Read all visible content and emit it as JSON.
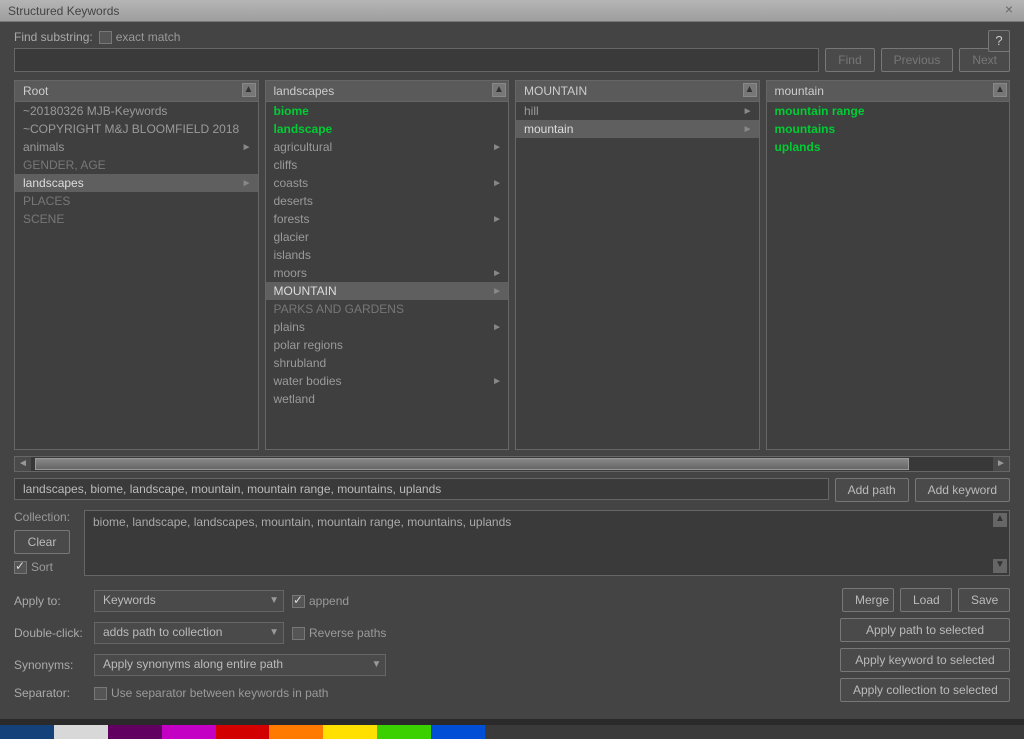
{
  "window": {
    "title": "Structured Keywords"
  },
  "find": {
    "label": "Find substring:",
    "exact_label": "exact match",
    "exact_checked": false,
    "find_btn": "Find",
    "prev_btn": "Previous",
    "next_btn": "Next",
    "help_btn": "?"
  },
  "columns": [
    {
      "header": "Root",
      "items": [
        {
          "label": "~20180326 MJB-Keywords",
          "has_children": false
        },
        {
          "label": "~COPYRIGHT M&J BLOOMFIELD 2018",
          "has_children": false
        },
        {
          "label": "animals",
          "has_children": true
        },
        {
          "label": "GENDER, AGE",
          "dim": true
        },
        {
          "label": "landscapes",
          "has_children": true,
          "selected": true
        },
        {
          "label": "PLACES",
          "dim": true
        },
        {
          "label": "SCENE",
          "dim": true
        }
      ]
    },
    {
      "header": "landscapes",
      "items": [
        {
          "label": "biome",
          "green": true
        },
        {
          "label": "landscape",
          "green": true
        },
        {
          "label": "agricultural",
          "has_children": true
        },
        {
          "label": "cliffs"
        },
        {
          "label": "coasts",
          "has_children": true
        },
        {
          "label": "deserts"
        },
        {
          "label": "forests",
          "has_children": true
        },
        {
          "label": "glacier"
        },
        {
          "label": "islands"
        },
        {
          "label": "moors",
          "has_children": true
        },
        {
          "label": "MOUNTAIN",
          "has_children": true,
          "selected": true
        },
        {
          "label": "PARKS AND GARDENS",
          "dim": true
        },
        {
          "label": "plains",
          "has_children": true
        },
        {
          "label": "polar regions"
        },
        {
          "label": "shrubland"
        },
        {
          "label": "water bodies",
          "has_children": true
        },
        {
          "label": "wetland"
        }
      ]
    },
    {
      "header": "MOUNTAIN",
      "items": [
        {
          "label": "hill",
          "has_children": true
        },
        {
          "label": "mountain",
          "has_children": true,
          "selected": true
        }
      ]
    },
    {
      "header": "mountain",
      "items": [
        {
          "label": "mountain range",
          "green": true
        },
        {
          "label": "mountains",
          "green": true
        },
        {
          "label": "uplands",
          "green": true
        }
      ]
    }
  ],
  "path": {
    "value": "landscapes, biome, landscape, mountain, mountain range, mountains, uplands",
    "add_path": "Add path",
    "add_keyword": "Add keyword"
  },
  "collection": {
    "label": "Collection:",
    "value": "biome, landscape, landscapes, mountain, mountain range, mountains, uplands",
    "clear": "Clear",
    "sort_label": "Sort",
    "sort_checked": true
  },
  "apply_to": {
    "label": "Apply to:",
    "value": "Keywords",
    "append_label": "append",
    "append_checked": true
  },
  "double_click": {
    "label": "Double-click:",
    "value": "adds path to collection",
    "reverse_label": "Reverse paths",
    "reverse_checked": false
  },
  "synonyms": {
    "label": "Synonyms:",
    "value": "Apply synonyms along entire path"
  },
  "separator": {
    "label": "Separator:",
    "use_label": "Use separator between keywords in path",
    "use_checked": false
  },
  "actions": {
    "merge": "Merge",
    "load": "Load",
    "save": "Save",
    "apply_path": "Apply path to selected",
    "apply_keyword": "Apply keyword to selected",
    "apply_collection": "Apply collection to selected"
  }
}
